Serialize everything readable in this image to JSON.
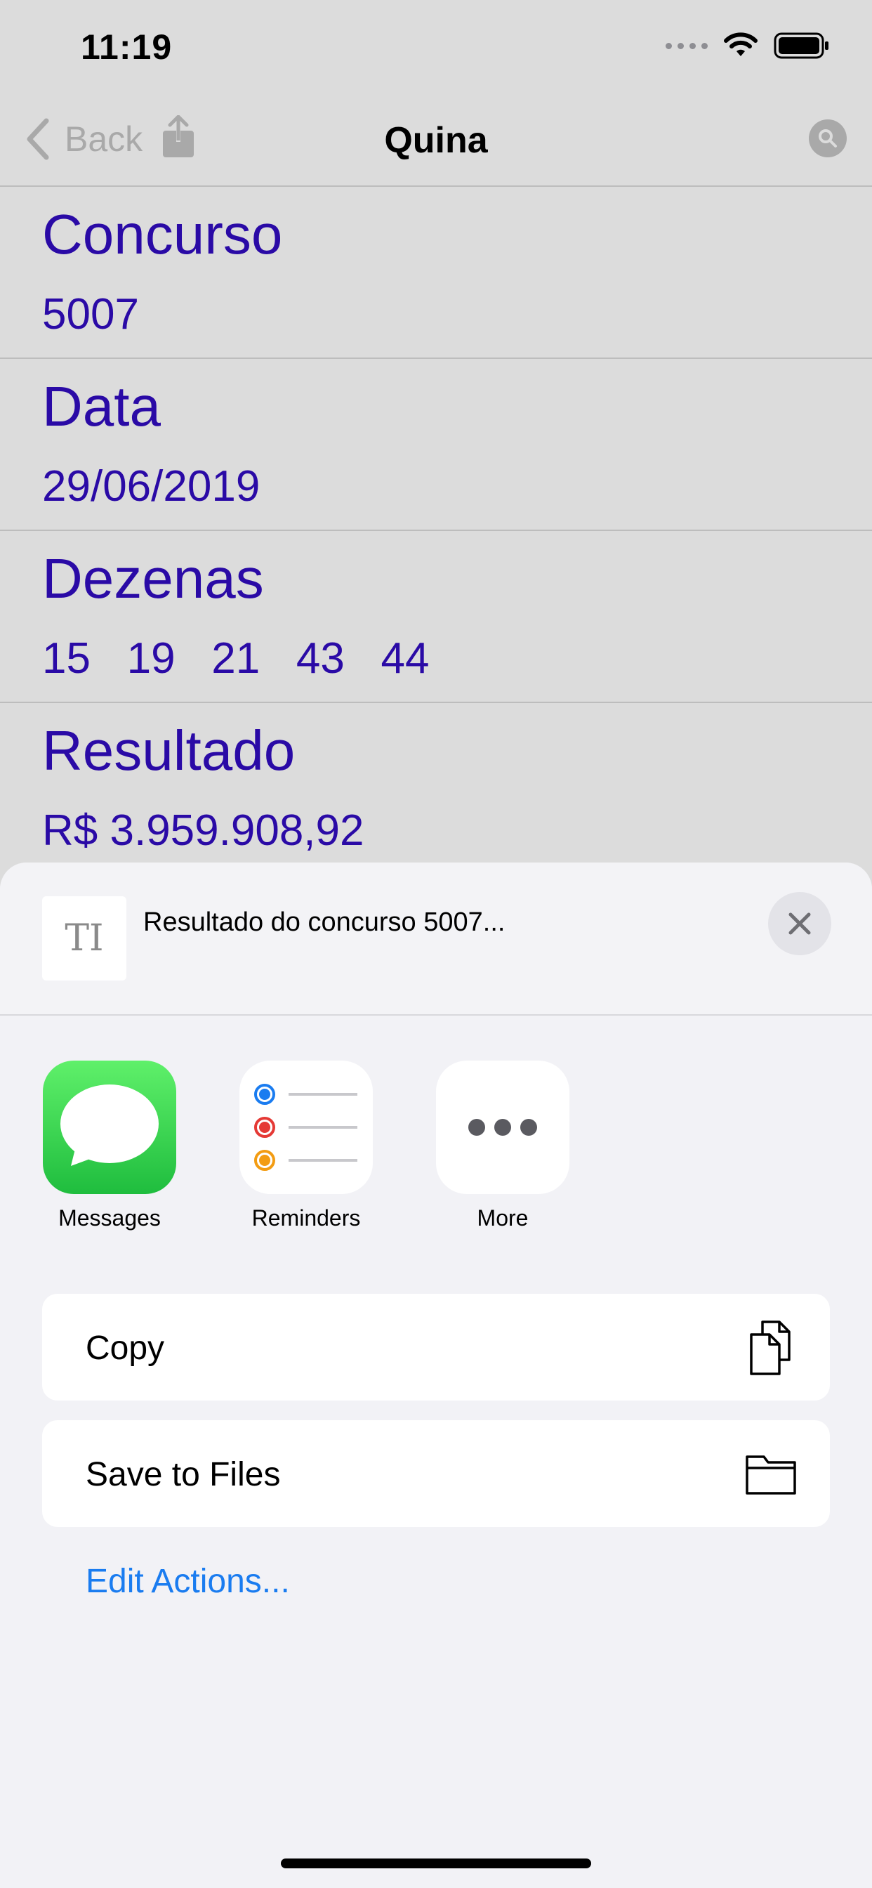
{
  "status_bar": {
    "time": "11:19"
  },
  "nav": {
    "back_label": "Back",
    "title": "Quina"
  },
  "fields": [
    {
      "title": "Concurso",
      "value": "5007"
    },
    {
      "title": "Data",
      "value": "29/06/2019"
    },
    {
      "title": "Dezenas",
      "value": "15   19   21   43   44"
    },
    {
      "title": "Resultado",
      "value": "R$ 3.959.908,92"
    }
  ],
  "share_sheet": {
    "preview_glyph": "TI",
    "preview_text": "Resultado do concurso 5007...",
    "apps": [
      {
        "label": "Messages",
        "icon": "messages-icon",
        "color": "#2fca4c"
      },
      {
        "label": "Reminders",
        "icon": "reminders-icon",
        "color": "#ffffff"
      },
      {
        "label": "More",
        "icon": "more-icon",
        "color": "#ffffff"
      }
    ],
    "actions": [
      {
        "label": "Copy",
        "icon": "copy-icon"
      },
      {
        "label": "Save to Files",
        "icon": "folder-icon"
      }
    ],
    "edit_actions_label": "Edit Actions..."
  },
  "colors": {
    "accent_text": "#2a0aa6",
    "link_blue": "#1a7cf0",
    "dim_background": "#dcdcdc",
    "sheet_background": "#f2f2f6"
  }
}
